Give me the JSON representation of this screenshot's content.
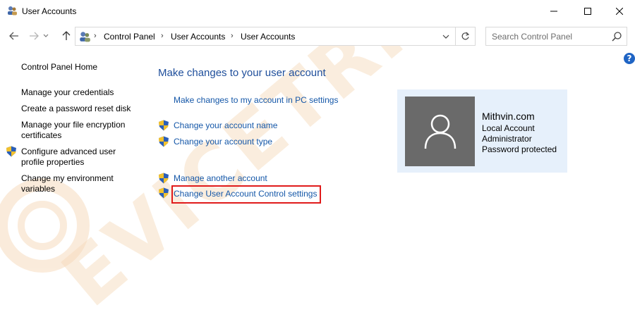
{
  "window": {
    "title": "User Accounts"
  },
  "address_bar": {
    "crumbs": [
      "Control Panel",
      "User Accounts",
      "User Accounts"
    ]
  },
  "search": {
    "placeholder": "Search Control Panel"
  },
  "left_pane": {
    "items": [
      {
        "label": "Control Panel Home",
        "shield": false
      },
      {
        "label": "Manage your credentials",
        "shield": false
      },
      {
        "label": "Create a password reset disk",
        "shield": false
      },
      {
        "label_line1": "Manage your file encryption",
        "label_line2": "certificates",
        "shield": false
      },
      {
        "label_line1": "Configure advanced user",
        "label_line2": "profile properties",
        "shield": true
      },
      {
        "label_line1": "Change my environment",
        "label_line2": "variables",
        "shield": false
      }
    ]
  },
  "main": {
    "title": "Make changes to your user account",
    "links": {
      "pc_settings": "Make changes to my account in PC settings",
      "change_name": "Change your account name",
      "change_type": "Change your account type",
      "manage_another": "Manage another account",
      "uac_settings": "Change User Account Control settings"
    }
  },
  "account": {
    "name": "Mithvin.com",
    "lines": [
      "Local Account",
      "Administrator",
      "Password protected"
    ]
  },
  "watermark": {
    "text": "EVICETRICKS"
  },
  "colors": {
    "link": "#1457a8",
    "title": "#1e4e9b",
    "highlight": "#e01b1b",
    "card": "#e6f0fb",
    "watermark": "#f5d6b0"
  }
}
